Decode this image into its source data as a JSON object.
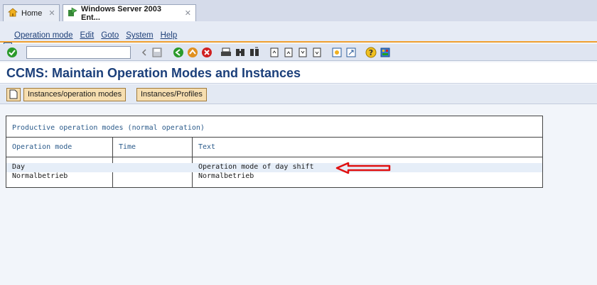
{
  "tabs": [
    {
      "label": "Home",
      "close": "✕"
    },
    {
      "label": "Windows Server 2003 Ent...",
      "close": "✕"
    }
  ],
  "menu": [
    "Operation mode",
    "Edit",
    "Goto",
    "System",
    "Help"
  ],
  "page_title": "CCMS: Maintain Operation Modes and Instances",
  "app_toolbar": {
    "btn1": "Instances/operation modes",
    "btn2": "Instances/Profiles"
  },
  "table": {
    "title": "Productive operation modes (normal operation)",
    "headers": [
      "Operation mode",
      "Time",
      "Text"
    ],
    "rows": [
      {
        "mode": "Day",
        "time": "",
        "text": "Operation mode of day shift"
      },
      {
        "mode": "Normalbetrieb",
        "time": "",
        "text": "Normalbetrieb"
      }
    ]
  },
  "colors": {
    "accent_orange": "#f0a030",
    "title_blue": "#1b3f7a",
    "arrow_red": "#e01010"
  },
  "icons": [
    "home-icon",
    "server-icon",
    "menu-icon",
    "enter-icon",
    "save-icon",
    "back-icon",
    "exit-icon",
    "cancel-icon",
    "print-icon",
    "find-icon",
    "find-next-icon",
    "first-page-icon",
    "prev-page-icon",
    "next-page-icon",
    "last-page-icon",
    "new-session-icon",
    "shortcut-icon",
    "help-icon",
    "layout-icon",
    "create-icon"
  ]
}
